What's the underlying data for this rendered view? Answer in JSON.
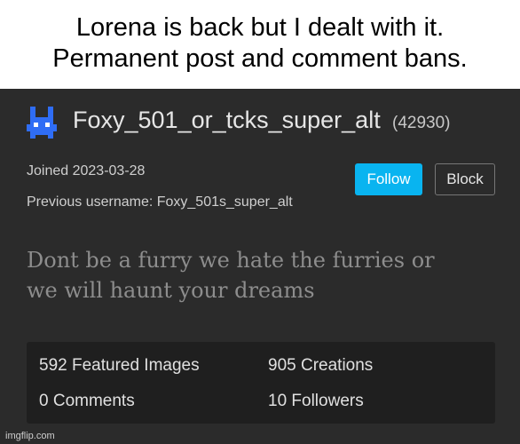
{
  "caption": {
    "line1": "Lorena is back but I dealt with it.",
    "line2": "Permanent post and comment bans."
  },
  "profile": {
    "username": "Foxy_501_or_tcks_super_alt",
    "user_id": "(42930)",
    "joined": "Joined 2023-03-28",
    "previous_username": "Previous username: Foxy_501s_super_alt",
    "bio_line1": "Dont be a furry we hate the furries or",
    "bio_line2": "we will haunt your dreams",
    "avatar_icon": "blue-pixel-creature-icon",
    "accent_color": "#09b4f0"
  },
  "actions": {
    "follow_label": "Follow",
    "block_label": "Block"
  },
  "stats": {
    "featured_images": "592 Featured Images",
    "creations": "905 Creations",
    "comments": "0 Comments",
    "followers": "10 Followers"
  },
  "watermark": "imgflip.com"
}
